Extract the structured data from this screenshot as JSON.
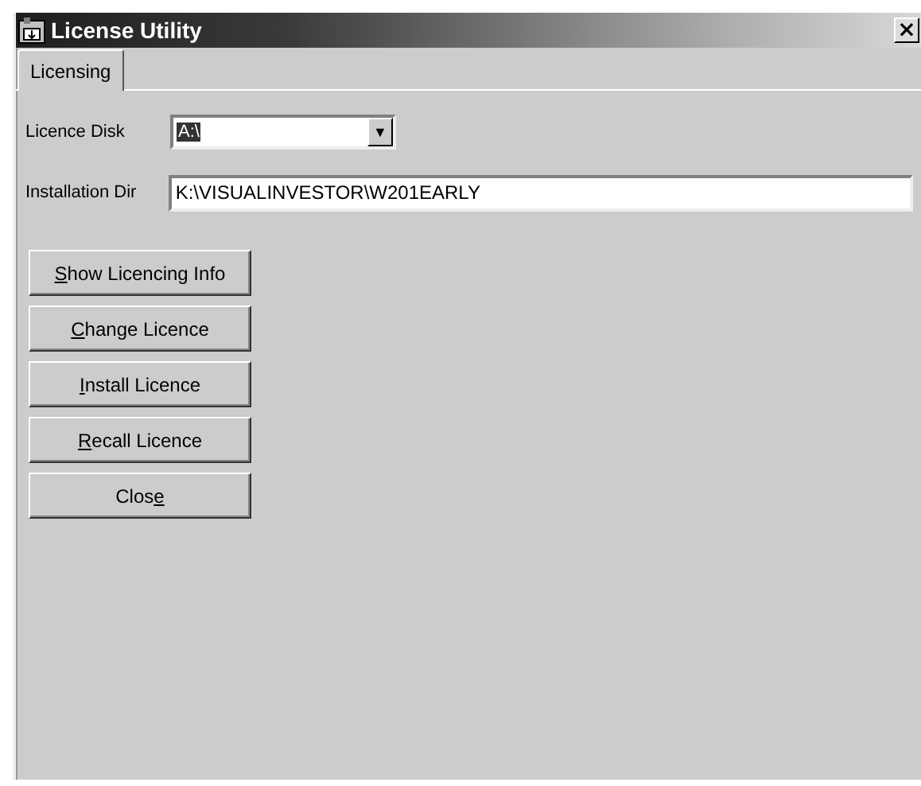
{
  "window": {
    "title": "License Utility",
    "close": "×"
  },
  "tabs": [
    {
      "label": "Licensing",
      "selected": true
    }
  ],
  "licence_disk": {
    "label": "Licence Disk",
    "value": "A:\\",
    "arrow": "▼"
  },
  "installation_dir": {
    "label": "Installation Dir",
    "value": "K:\\VISUALINVESTOR\\W201EARLY"
  },
  "buttons": [
    {
      "key": "S",
      "after": "how Licencing Info"
    },
    {
      "key": "C",
      "after": "hange Licence"
    },
    {
      "key": "I",
      "after": "nstall Licence"
    },
    {
      "key": "R",
      "after": "ecall Licence"
    },
    {
      "before": "Clos",
      "key": "e"
    }
  ]
}
